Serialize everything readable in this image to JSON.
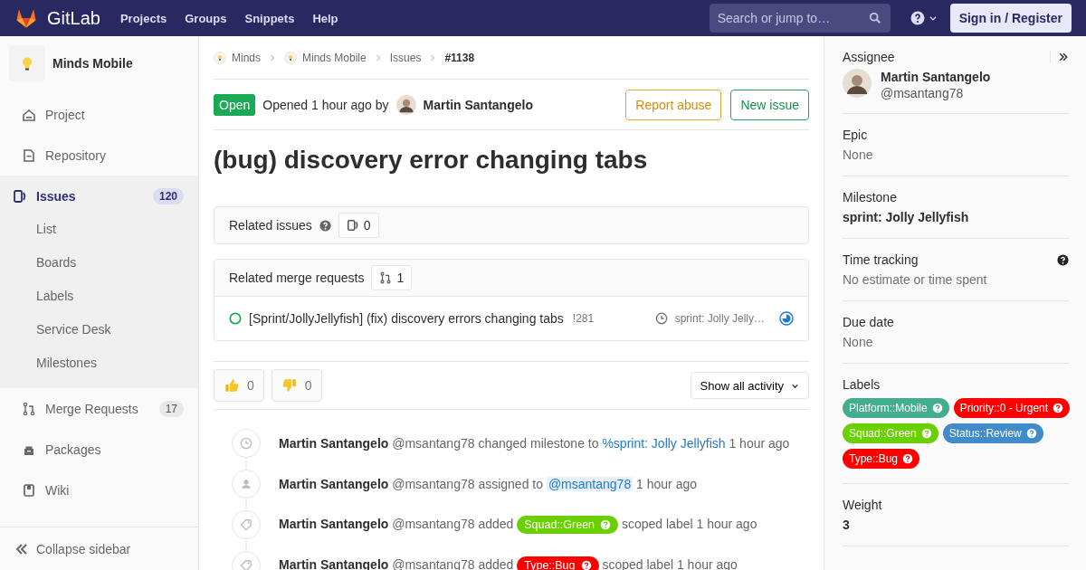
{
  "header": {
    "logo": "GitLab",
    "nav": [
      "Projects",
      "Groups",
      "Snippets",
      "Help"
    ],
    "search": {
      "placeholder": "Search or jump to…"
    },
    "sign_in": "Sign in / Register"
  },
  "sidebar": {
    "project": "Minds Mobile",
    "items": [
      {
        "kind": "project",
        "label": "Project",
        "selected": false
      },
      {
        "kind": "repository",
        "label": "Repository",
        "selected": false
      },
      {
        "kind": "issues",
        "label": "Issues",
        "count": "120",
        "selected": true,
        "children": [
          {
            "label": "List"
          },
          {
            "label": "Boards"
          },
          {
            "label": "Labels"
          },
          {
            "label": "Service Desk"
          },
          {
            "label": "Milestones"
          }
        ]
      },
      {
        "kind": "merge",
        "label": "Merge Requests",
        "count": "17",
        "selected": false
      },
      {
        "kind": "packages",
        "label": "Packages",
        "selected": false
      },
      {
        "kind": "wiki",
        "label": "Wiki",
        "selected": false
      }
    ],
    "collapse": "Collapse sidebar"
  },
  "breadcrumbs": [
    {
      "kind": "group",
      "text": "Minds"
    },
    {
      "kind": "project",
      "text": "Minds Mobile"
    },
    {
      "kind": "page",
      "text": "Issues"
    },
    {
      "kind": "current",
      "text": "#1138"
    }
  ],
  "issue": {
    "status": "Open",
    "opened": "Opened 1 hour ago by",
    "author": "Martin Santangelo",
    "actions": [
      "Report abuse",
      "New issue"
    ],
    "title": "(bug) discovery error changing tabs"
  },
  "related_issues": {
    "title": "Related issues",
    "count": "0"
  },
  "related_merge_requests": {
    "title": "Related merge requests",
    "count": "1",
    "items": [
      {
        "title": "[Sprint/JollyJellyfish] (fix) discovery errors changing tabs",
        "ref": "!281",
        "milestone": "sprint: Jolly Jelly…"
      }
    ]
  },
  "awards": [
    {
      "kind": "thumbsup",
      "count": "0"
    },
    {
      "kind": "thumbsdown",
      "count": "0"
    }
  ],
  "activity_filter": "Show all activity",
  "notes": [
    {
      "kind": "milestone",
      "author": "Martin Santangelo",
      "handle": "@msantang78",
      "action": "changed milestone to",
      "ref": {
        "kind": "link",
        "text": "%sprint: Jolly Jellyfish"
      },
      "time": "1 hour ago"
    },
    {
      "kind": "assignee",
      "author": "Martin Santangelo",
      "handle": "@msantang78",
      "action": "assigned to",
      "ref": {
        "kind": "mention",
        "text": "@msantang78"
      },
      "time": "1 hour ago"
    },
    {
      "kind": "label",
      "author": "Martin Santangelo",
      "handle": "@msantang78",
      "action": "added",
      "ref": {
        "kind": "label",
        "text": "Squad::Green",
        "color": "#69d100"
      },
      "after": "scoped label",
      "time": "1 hour ago"
    },
    {
      "kind": "label",
      "author": "Martin Santangelo",
      "handle": "@msantang78",
      "action": "added",
      "ref": {
        "kind": "label",
        "text": "Type::Bug",
        "color": "#ff0000"
      },
      "after": "scoped label",
      "time": "1 hour ago"
    }
  ],
  "right_sidebar": {
    "assignee": {
      "title": "Assignee",
      "name": "Martin Santangelo",
      "handle": "@msantang78"
    },
    "blocks": [
      {
        "kind": "plain",
        "title": "Epic",
        "value": "None"
      },
      {
        "kind": "bold",
        "title": "Milestone",
        "value": "sprint: Jolly Jellyfish"
      },
      {
        "kind": "help",
        "title": "Time tracking",
        "value": "No estimate or time spent"
      },
      {
        "kind": "plain",
        "title": "Due date",
        "value": "None"
      }
    ],
    "labels": {
      "title": "Labels",
      "items": [
        {
          "text": "Platform::Mobile",
          "color": "#44ad8e"
        },
        {
          "text": "Priority::0 - Urgent",
          "color": "#ff0000"
        },
        {
          "text": "Squad::Green",
          "color": "#69d100"
        },
        {
          "text": "Status::Review",
          "color": "#428bca"
        },
        {
          "text": "Type::Bug",
          "color": "#ff0000"
        }
      ]
    },
    "weight": {
      "title": "Weight",
      "value": "3"
    }
  }
}
